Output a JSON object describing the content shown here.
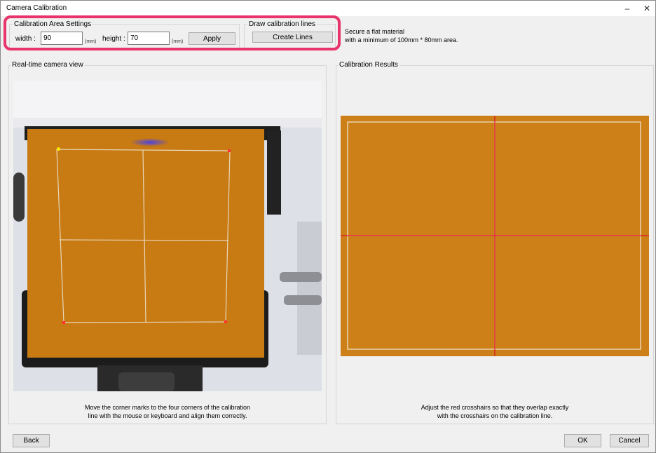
{
  "window": {
    "title": "Camera Calibration",
    "minimize_symbol": "–",
    "close_symbol": "✕"
  },
  "calibration_area": {
    "legend": "Calibration Area Settings",
    "width_label": "width :",
    "width_value": "90",
    "width_unit": "(mm)",
    "height_label": "height :",
    "height_value": "70",
    "height_unit": "(mm)",
    "apply_label": "Apply"
  },
  "draw_lines": {
    "legend": "Draw calibration lines",
    "create_label": "Create Lines"
  },
  "info": {
    "line1": "Secure a flat material",
    "line2": "with a minimum of 100mm * 80mm area."
  },
  "camera_panel": {
    "legend": "Real-time camera view",
    "instruction_line1": "Move the corner marks to the four corners of the calibration",
    "instruction_line2": "line with the mouse or keyboard and align them correctly."
  },
  "results_panel": {
    "legend": "Calibration Results",
    "instruction_line1": "Adjust the red crosshairs so that they overlap exactly",
    "instruction_line2": "with the crosshairs on the calibration line."
  },
  "footer": {
    "back_label": "Back",
    "ok_label": "OK",
    "cancel_label": "Cancel"
  },
  "colors": {
    "highlight": "#e8336b",
    "material_orange": "#cc7d14",
    "crosshair_red": "#e0102a",
    "corner_dot": "#ffe800"
  }
}
